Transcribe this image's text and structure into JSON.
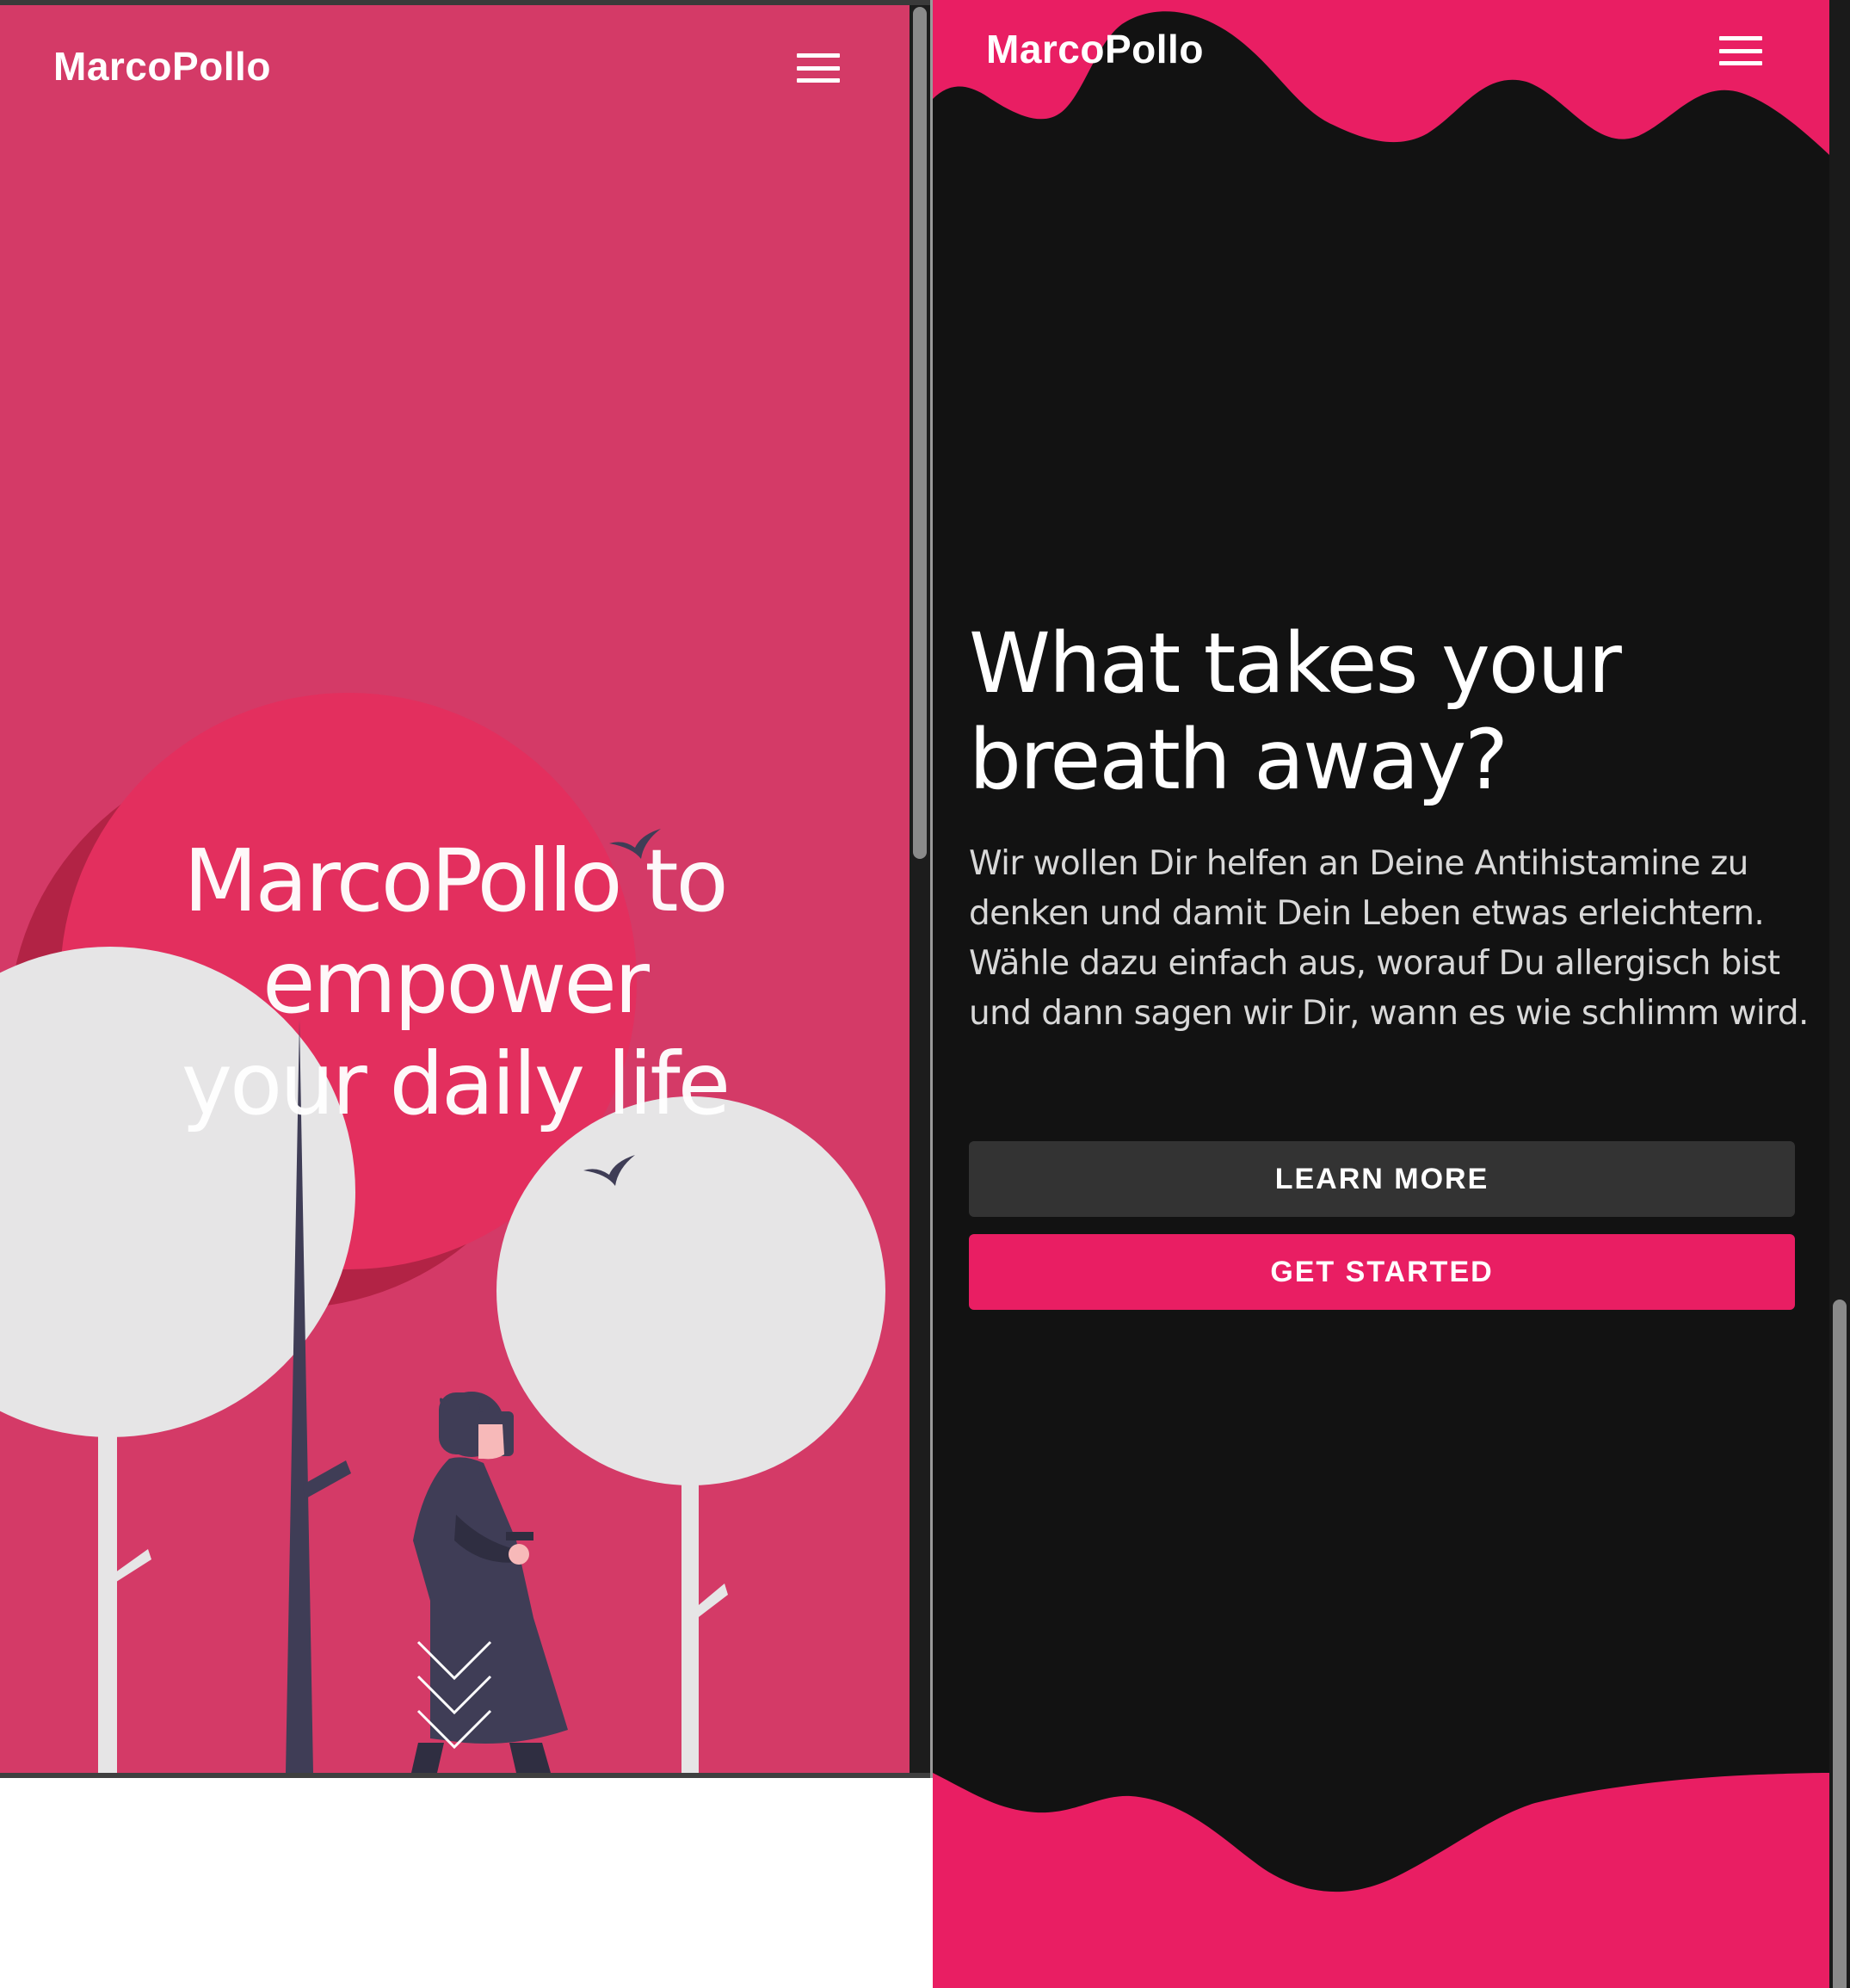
{
  "theme": {
    "left_background": "#d43a67",
    "right_background": "#121212",
    "accent": "#e91e63",
    "button_secondary": "#333333",
    "tree_light": "#e6e5e6",
    "sun_main": "#e32f5e",
    "sun_shadow": "#b22345",
    "figure_dark": "#3f3d56"
  },
  "left_panel": {
    "brand": "MarcoPollo",
    "menu_icon": "hamburger-menu-icon",
    "hero": {
      "line1": "MarcoPollo to empower",
      "line2": "your daily life"
    },
    "scroll_icon": "triple-chevron-down-icon"
  },
  "right_panel": {
    "brand": "MarcoPollo",
    "menu_icon": "hamburger-menu-icon",
    "heading": {
      "line1": "What takes your",
      "line2": "breath away?"
    },
    "body": {
      "line1": "Wir wollen Dir helfen an Deine Antihistamine zu",
      "line2": "denken und damit Dein Leben etwas erleichtern.",
      "line3": "Wähle dazu einfach aus, worauf Du allergisch bist",
      "line4": "und dann sagen wir Dir, wann es wie schlimm wird."
    },
    "buttons": {
      "learn_more": "LEARN MORE",
      "get_started": "GET STARTED"
    }
  }
}
